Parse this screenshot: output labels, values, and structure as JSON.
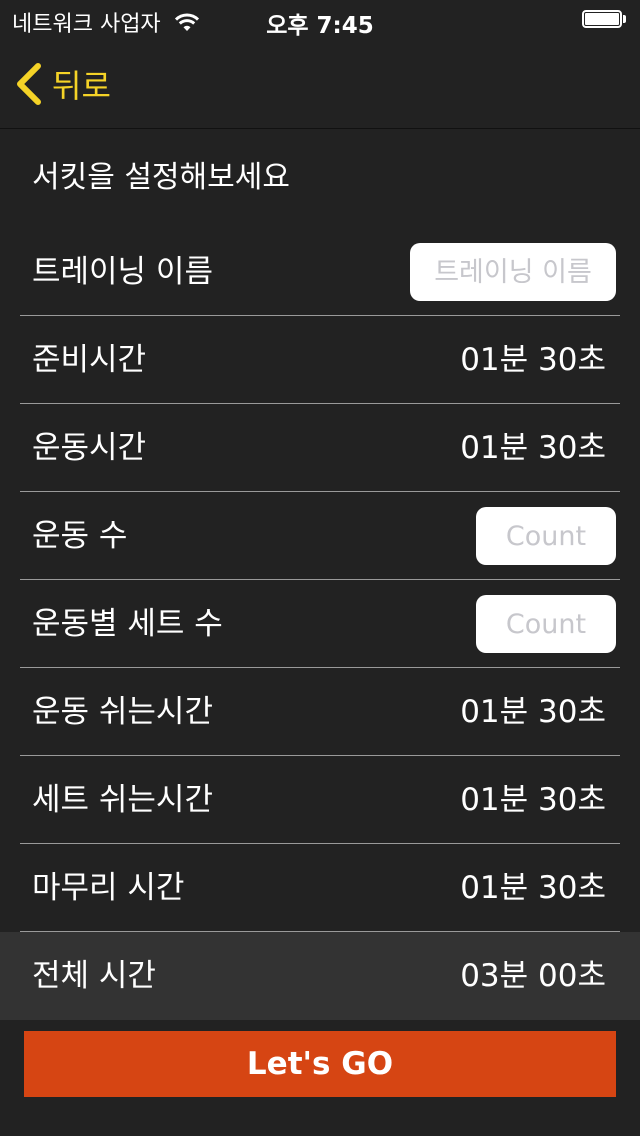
{
  "status_bar": {
    "carrier": "네트워크 사업자",
    "time": "오후 7:45"
  },
  "nav": {
    "back_label": "뒤로"
  },
  "section": {
    "title": "서킷을 설정해보세요"
  },
  "rows": [
    {
      "label": "트레이닝 이름",
      "input_placeholder": "트레이닝 이름"
    },
    {
      "label": "준비시간",
      "value": "01분 30초"
    },
    {
      "label": "운동시간",
      "value": "01분 30초"
    },
    {
      "label": "운동 수",
      "input_placeholder": "Count"
    },
    {
      "label": "운동별 세트 수",
      "input_placeholder": "Count"
    },
    {
      "label": "운동 쉬는시간",
      "value": "01분 30초"
    },
    {
      "label": "세트 쉬는시간",
      "value": "01분 30초"
    },
    {
      "label": "마무리 시간",
      "value": "01분 30초"
    }
  ],
  "total": {
    "label": "전체 시간",
    "value": "03분 00초"
  },
  "go_button": {
    "label": "Let's GO"
  },
  "colors": {
    "background": "#222222",
    "accent_yellow": "#f5d327",
    "go_orange": "#d64513",
    "total_row": "#333333"
  }
}
